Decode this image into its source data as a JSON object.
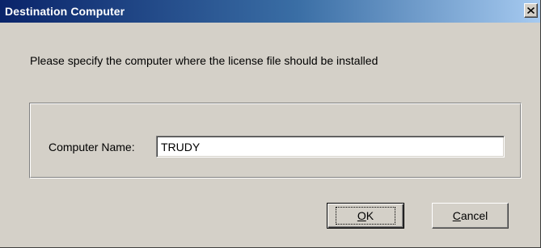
{
  "window": {
    "title": "Destination Computer",
    "close_icon": "close-icon"
  },
  "instruction": "Please specify the computer where the license file should be installed",
  "form": {
    "computer_name_label": "Computer Name:",
    "computer_name_value": "TRUDY"
  },
  "buttons": {
    "ok_mnemonic": "O",
    "ok_rest": "K",
    "cancel_mnemonic": "C",
    "cancel_rest": "ancel"
  },
  "colors": {
    "titlebar_start": "#0a246a",
    "titlebar_end": "#a6caf0",
    "dialog_face": "#d4d0c8"
  }
}
